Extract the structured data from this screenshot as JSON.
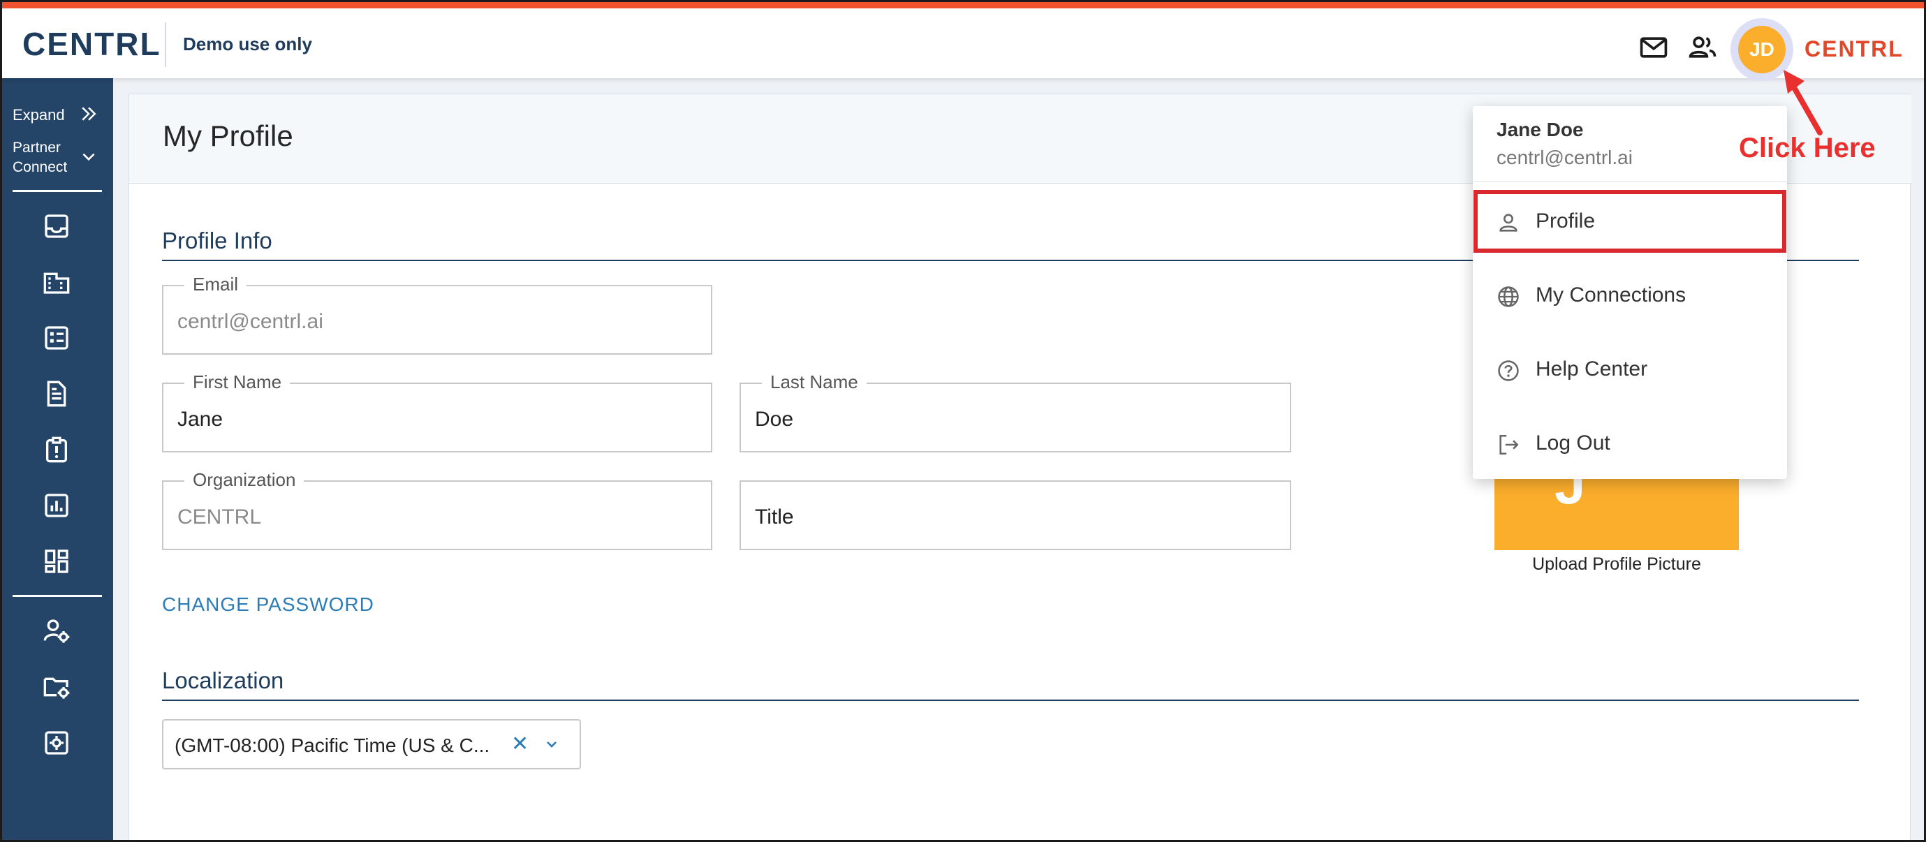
{
  "header": {
    "brand": "CENTRL",
    "demo_label": "Demo use only",
    "mail_icon": "mail-icon",
    "people_icon": "people-icon",
    "avatar_initials": "JD",
    "org_name": "CENTRL"
  },
  "sidebar": {
    "expand_label": "Expand",
    "partner_line1": "Partner",
    "partner_line2": "Connect",
    "icons": [
      "inbox-icon",
      "building-icon",
      "checklist-icon",
      "document-icon",
      "clipboard-alert-icon",
      "bar-chart-icon",
      "dashboard-icon",
      "user-settings-icon",
      "folder-settings-icon",
      "settings-box-icon"
    ]
  },
  "page": {
    "title": "My Profile"
  },
  "profile_info": {
    "section_title": "Profile Info",
    "email": {
      "label": "Email",
      "value": "centrl@centrl.ai"
    },
    "first_name": {
      "label": "First Name",
      "value": "Jane"
    },
    "last_name": {
      "label": "Last Name",
      "value": "Doe"
    },
    "organization": {
      "label": "Organization",
      "value": "CENTRL"
    },
    "title": {
      "placeholder": "Title"
    },
    "change_password": "CHANGE PASSWORD",
    "upload_label": "Upload Profile Picture",
    "upload_letter": "J"
  },
  "localization": {
    "section_title": "Localization",
    "timezone_value": "(GMT-08:00) Pacific Time (US & C...",
    "clear_glyph": "✕"
  },
  "user_menu": {
    "name": "Jane Doe",
    "email": "centrl@centrl.ai",
    "items": [
      {
        "label": "Profile",
        "icon": "person-icon"
      },
      {
        "label": "My Connections",
        "icon": "globe-icon"
      },
      {
        "label": "Help Center",
        "icon": "help-icon"
      },
      {
        "label": "Log Out",
        "icon": "logout-icon"
      }
    ]
  },
  "annotation": {
    "text": "Click Here",
    "color": "#e8302f"
  },
  "colors": {
    "accent": "#f0532d",
    "sidebar": "#244468",
    "avatar": "#fbad2c",
    "link": "#2c7cb5"
  }
}
